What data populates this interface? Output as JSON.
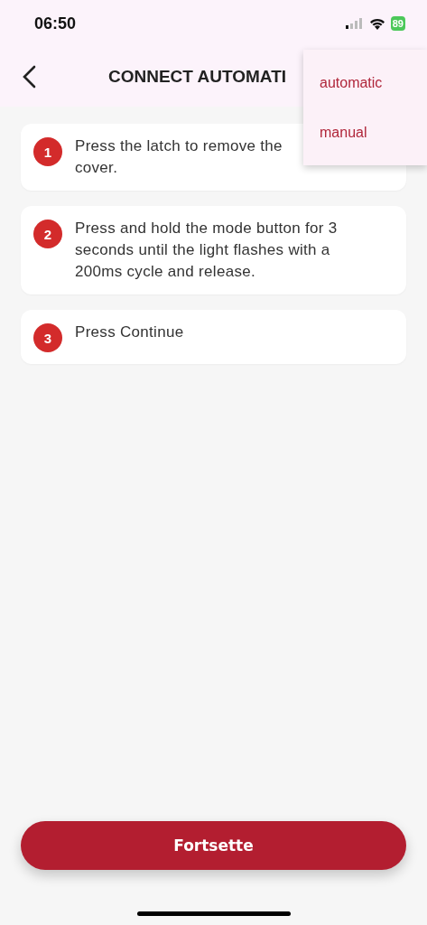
{
  "status_bar": {
    "time": "06:50",
    "battery": "89"
  },
  "header": {
    "title": "CONNECT AUTOMATI"
  },
  "menu": {
    "items": [
      {
        "label": "automatic"
      },
      {
        "label": "manual"
      }
    ]
  },
  "steps": [
    {
      "number": "1",
      "text": "Press the latch to remove the cover."
    },
    {
      "number": "2",
      "text": "Press and hold the mode button for 3 seconds until the light flashes with a 200ms cycle and release."
    },
    {
      "number": "3",
      "text": "Press Continue"
    }
  ],
  "continue_button": {
    "label": "Fortsette"
  }
}
